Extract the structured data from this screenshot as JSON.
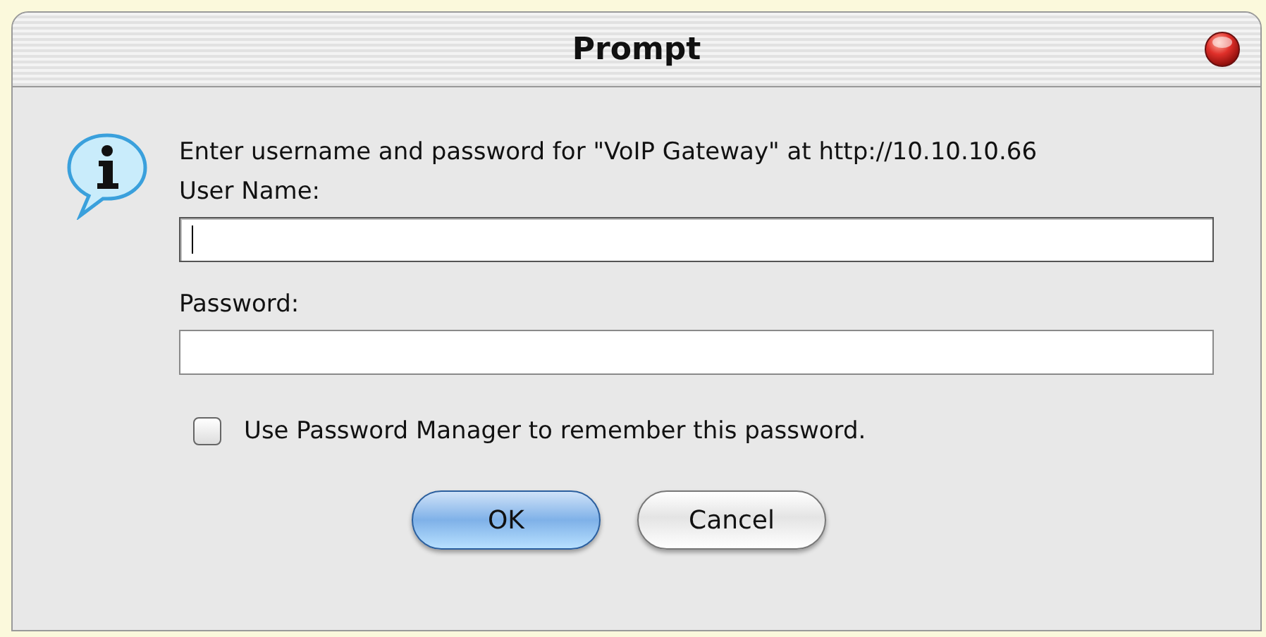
{
  "window": {
    "title": "Prompt"
  },
  "message": "Enter username and password for \"VoIP Gateway\" at http://10.10.10.66",
  "fields": [
    {
      "label": "User Name:",
      "focused": true
    },
    {
      "label": "Password:",
      "focused": false
    }
  ],
  "remember": {
    "label": "Use Password Manager to remember this password.",
    "checked": false
  },
  "buttons": [
    {
      "label": "OK",
      "default": true
    },
    {
      "label": "Cancel",
      "default": false
    }
  ]
}
